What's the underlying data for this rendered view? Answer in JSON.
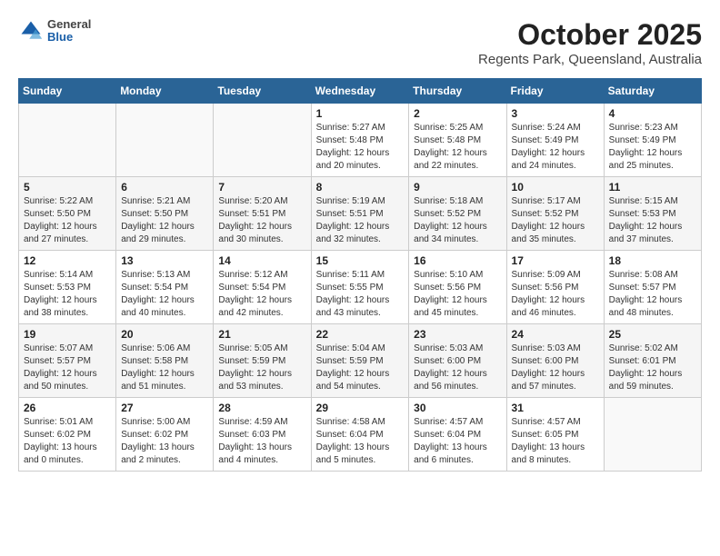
{
  "header": {
    "logo_general": "General",
    "logo_blue": "Blue",
    "title": "October 2025",
    "subtitle": "Regents Park, Queensland, Australia"
  },
  "calendar": {
    "days_of_week": [
      "Sunday",
      "Monday",
      "Tuesday",
      "Wednesday",
      "Thursday",
      "Friday",
      "Saturday"
    ],
    "weeks": [
      [
        {
          "day": "",
          "info": ""
        },
        {
          "day": "",
          "info": ""
        },
        {
          "day": "",
          "info": ""
        },
        {
          "day": "1",
          "info": "Sunrise: 5:27 AM\nSunset: 5:48 PM\nDaylight: 12 hours\nand 20 minutes."
        },
        {
          "day": "2",
          "info": "Sunrise: 5:25 AM\nSunset: 5:48 PM\nDaylight: 12 hours\nand 22 minutes."
        },
        {
          "day": "3",
          "info": "Sunrise: 5:24 AM\nSunset: 5:49 PM\nDaylight: 12 hours\nand 24 minutes."
        },
        {
          "day": "4",
          "info": "Sunrise: 5:23 AM\nSunset: 5:49 PM\nDaylight: 12 hours\nand 25 minutes."
        }
      ],
      [
        {
          "day": "5",
          "info": "Sunrise: 5:22 AM\nSunset: 5:50 PM\nDaylight: 12 hours\nand 27 minutes."
        },
        {
          "day": "6",
          "info": "Sunrise: 5:21 AM\nSunset: 5:50 PM\nDaylight: 12 hours\nand 29 minutes."
        },
        {
          "day": "7",
          "info": "Sunrise: 5:20 AM\nSunset: 5:51 PM\nDaylight: 12 hours\nand 30 minutes."
        },
        {
          "day": "8",
          "info": "Sunrise: 5:19 AM\nSunset: 5:51 PM\nDaylight: 12 hours\nand 32 minutes."
        },
        {
          "day": "9",
          "info": "Sunrise: 5:18 AM\nSunset: 5:52 PM\nDaylight: 12 hours\nand 34 minutes."
        },
        {
          "day": "10",
          "info": "Sunrise: 5:17 AM\nSunset: 5:52 PM\nDaylight: 12 hours\nand 35 minutes."
        },
        {
          "day": "11",
          "info": "Sunrise: 5:15 AM\nSunset: 5:53 PM\nDaylight: 12 hours\nand 37 minutes."
        }
      ],
      [
        {
          "day": "12",
          "info": "Sunrise: 5:14 AM\nSunset: 5:53 PM\nDaylight: 12 hours\nand 38 minutes."
        },
        {
          "day": "13",
          "info": "Sunrise: 5:13 AM\nSunset: 5:54 PM\nDaylight: 12 hours\nand 40 minutes."
        },
        {
          "day": "14",
          "info": "Sunrise: 5:12 AM\nSunset: 5:54 PM\nDaylight: 12 hours\nand 42 minutes."
        },
        {
          "day": "15",
          "info": "Sunrise: 5:11 AM\nSunset: 5:55 PM\nDaylight: 12 hours\nand 43 minutes."
        },
        {
          "day": "16",
          "info": "Sunrise: 5:10 AM\nSunset: 5:56 PM\nDaylight: 12 hours\nand 45 minutes."
        },
        {
          "day": "17",
          "info": "Sunrise: 5:09 AM\nSunset: 5:56 PM\nDaylight: 12 hours\nand 46 minutes."
        },
        {
          "day": "18",
          "info": "Sunrise: 5:08 AM\nSunset: 5:57 PM\nDaylight: 12 hours\nand 48 minutes."
        }
      ],
      [
        {
          "day": "19",
          "info": "Sunrise: 5:07 AM\nSunset: 5:57 PM\nDaylight: 12 hours\nand 50 minutes."
        },
        {
          "day": "20",
          "info": "Sunrise: 5:06 AM\nSunset: 5:58 PM\nDaylight: 12 hours\nand 51 minutes."
        },
        {
          "day": "21",
          "info": "Sunrise: 5:05 AM\nSunset: 5:59 PM\nDaylight: 12 hours\nand 53 minutes."
        },
        {
          "day": "22",
          "info": "Sunrise: 5:04 AM\nSunset: 5:59 PM\nDaylight: 12 hours\nand 54 minutes."
        },
        {
          "day": "23",
          "info": "Sunrise: 5:03 AM\nSunset: 6:00 PM\nDaylight: 12 hours\nand 56 minutes."
        },
        {
          "day": "24",
          "info": "Sunrise: 5:03 AM\nSunset: 6:00 PM\nDaylight: 12 hours\nand 57 minutes."
        },
        {
          "day": "25",
          "info": "Sunrise: 5:02 AM\nSunset: 6:01 PM\nDaylight: 12 hours\nand 59 minutes."
        }
      ],
      [
        {
          "day": "26",
          "info": "Sunrise: 5:01 AM\nSunset: 6:02 PM\nDaylight: 13 hours\nand 0 minutes."
        },
        {
          "day": "27",
          "info": "Sunrise: 5:00 AM\nSunset: 6:02 PM\nDaylight: 13 hours\nand 2 minutes."
        },
        {
          "day": "28",
          "info": "Sunrise: 4:59 AM\nSunset: 6:03 PM\nDaylight: 13 hours\nand 4 minutes."
        },
        {
          "day": "29",
          "info": "Sunrise: 4:58 AM\nSunset: 6:04 PM\nDaylight: 13 hours\nand 5 minutes."
        },
        {
          "day": "30",
          "info": "Sunrise: 4:57 AM\nSunset: 6:04 PM\nDaylight: 13 hours\nand 6 minutes."
        },
        {
          "day": "31",
          "info": "Sunrise: 4:57 AM\nSunset: 6:05 PM\nDaylight: 13 hours\nand 8 minutes."
        },
        {
          "day": "",
          "info": ""
        }
      ]
    ]
  }
}
